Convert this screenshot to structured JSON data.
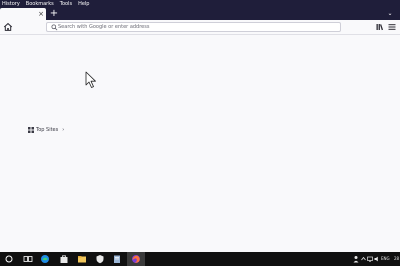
{
  "menu": {
    "items": [
      {
        "label": "History"
      },
      {
        "label": "Bookmarks"
      },
      {
        "label": "Tools"
      },
      {
        "label": "Help"
      }
    ]
  },
  "tab": {
    "close_symbol": "×"
  },
  "toolbar": {
    "new_tab_symbol": "+",
    "tab_list_symbol": "⌄"
  },
  "urlbar": {
    "placeholder": "Search with Google or enter address"
  },
  "newtab": {
    "topsites_label": "Top Sites",
    "chevron": "›"
  },
  "taskbar": {
    "language": "ENG",
    "clock_partial": "28"
  },
  "icons": {
    "home": "home-icon",
    "search": "search-icon",
    "library": "library-icon",
    "menu": "hamburger-menu-icon",
    "topsites": "grid-icon"
  },
  "colors": {
    "titlebar": "#1f1e3a",
    "page_bg": "#f9f9fb",
    "taskbar": "#101010",
    "firefox_accent": "#ff7139"
  }
}
